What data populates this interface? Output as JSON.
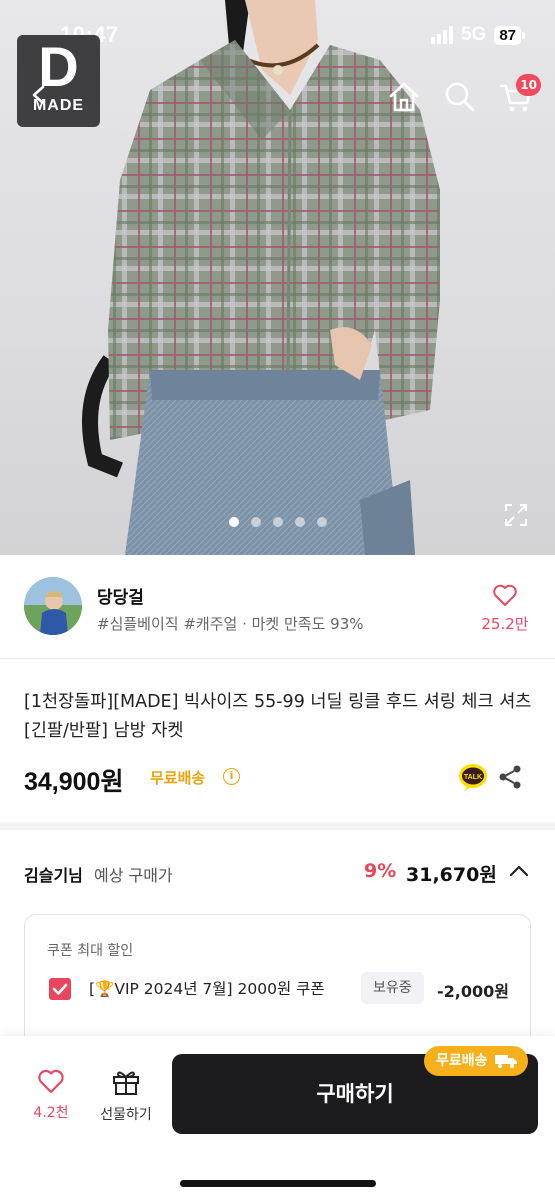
{
  "status_bar": {
    "time": "10:47",
    "network": "5G",
    "battery": "87"
  },
  "brand_logo": {
    "letter": "D",
    "name": "MADE"
  },
  "header": {
    "cart_count": "10"
  },
  "gallery": {
    "dots": 5,
    "active_index": 0
  },
  "seller": {
    "name": "당당걸",
    "tags": "#심플베이직 #캐주얼 · 마켓 만족도 93%",
    "like_count": "25.2만"
  },
  "product": {
    "title": "[1천장돌파][MADE] 빅사이즈 55-99 너딜 링클 후드 셔링 체크 셔츠 [긴팔/반팔] 남방 자켓",
    "price": "34,900원",
    "free_shipping": "무료배송",
    "talk_label": "TALK"
  },
  "expected": {
    "user": "김슬기님",
    "label": "예상 구매가",
    "discount": "9%",
    "price": "31,670원"
  },
  "coupon": {
    "heading": "쿠폰 최대 할인",
    "name": "[🏆VIP 2024년 7월] 2000원 쿠폰",
    "owned": "보유중",
    "amount": "-2,000원"
  },
  "bottom_bar": {
    "like_count": "4.2천",
    "gift_label": "선물하기",
    "buy_label": "구매하기",
    "ship_badge": "무료배송"
  },
  "colors": {
    "accent": "#e8465c",
    "ship": "#f6b01c",
    "buy": "#1c1c1e"
  }
}
